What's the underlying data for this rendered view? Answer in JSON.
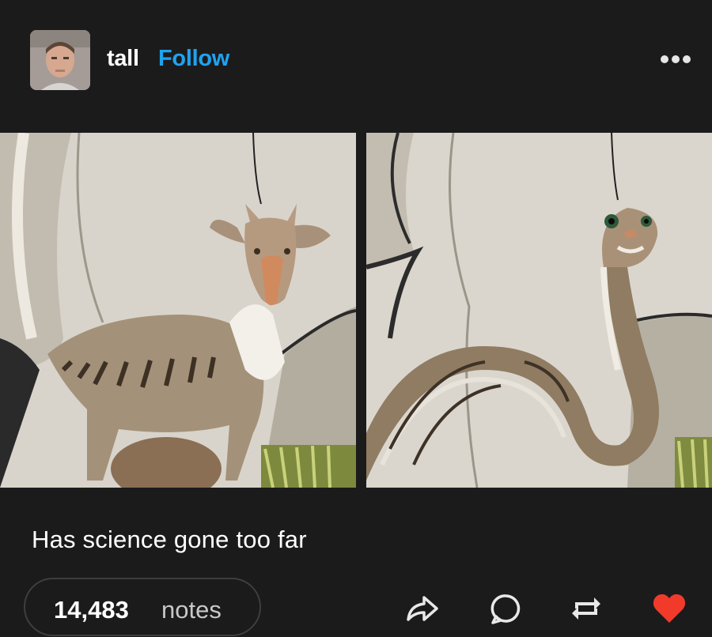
{
  "post": {
    "username": "tall",
    "follow_label": "Follow",
    "caption": "Has science gone too far",
    "notes_count": "14,483",
    "notes_label": "notes"
  },
  "icons": {
    "more": "more-options-icon",
    "share": "share-icon",
    "reply": "reply-icon",
    "reblog": "reblog-icon",
    "like": "heart-icon"
  },
  "colors": {
    "background": "#1b1b1c",
    "accent": "#1fa3f0",
    "like": "#f23a2b"
  }
}
